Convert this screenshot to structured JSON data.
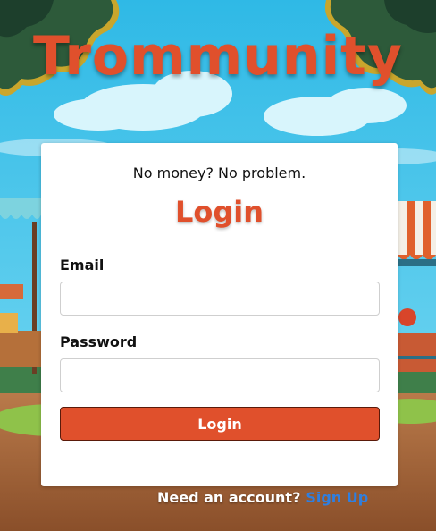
{
  "brand": {
    "title": "Trommunity"
  },
  "card": {
    "tagline": "No money? No problem.",
    "heading": "Login",
    "email_label": "Email",
    "email_value": "",
    "password_label": "Password",
    "password_value": "",
    "submit_label": "Login"
  },
  "footer": {
    "prompt": "Need an account?",
    "signup_link": "Sign Up"
  },
  "colors": {
    "accent": "#e0502c",
    "link": "#2f7fe0",
    "sky": "#3cc4ea"
  }
}
